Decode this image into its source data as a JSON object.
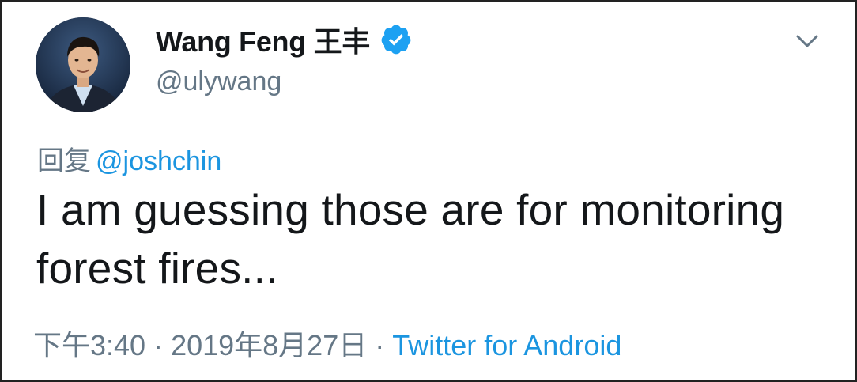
{
  "tweet": {
    "author": {
      "display_name": "Wang Feng 王丰",
      "handle": "@ulywang",
      "verified_icon": "verified-badge-icon",
      "avatar": "profile-photo"
    },
    "menu_icon": "chevron-down-icon",
    "reply": {
      "prefix": "回复",
      "to": "@joshchin"
    },
    "text": "I am guessing those are for monitoring forest fires...",
    "meta": {
      "time": "下午3:40",
      "separator": "·",
      "date": "2019年8月27日",
      "source": "Twitter for Android"
    }
  },
  "colors": {
    "text": "#14171a",
    "secondary": "#657786",
    "link": "#1b95e0",
    "verified": "#1da1f2",
    "border": "#222222"
  }
}
